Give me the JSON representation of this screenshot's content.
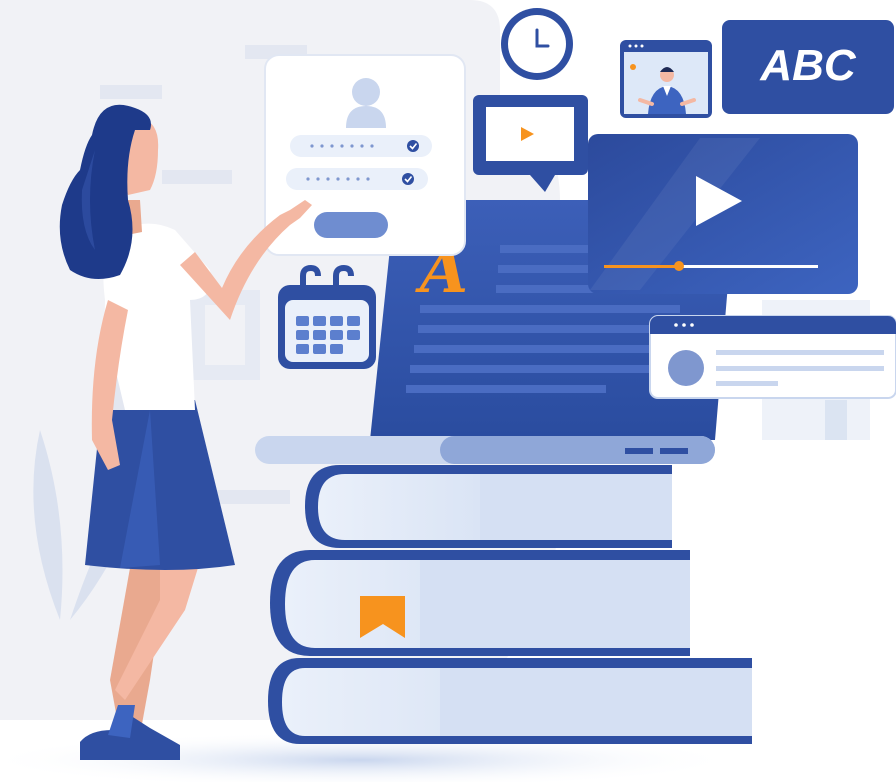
{
  "scene": {
    "abc_card": {
      "label": "ABC"
    },
    "ebook": {
      "initial_letter": "A"
    },
    "colors": {
      "primary_blue": "#2f4fa2",
      "dark_blue": "#1e3a8a",
      "light_blue": "#dbe6f7",
      "accent_orange": "#f7931e",
      "skin": "#f4b8a3",
      "background_gray": "#f1f2f6"
    },
    "icons": [
      "clock-icon",
      "calendar-icon",
      "play-icon",
      "user-icon",
      "checkmark-icon",
      "bookmark-icon",
      "video-call-icon"
    ]
  }
}
